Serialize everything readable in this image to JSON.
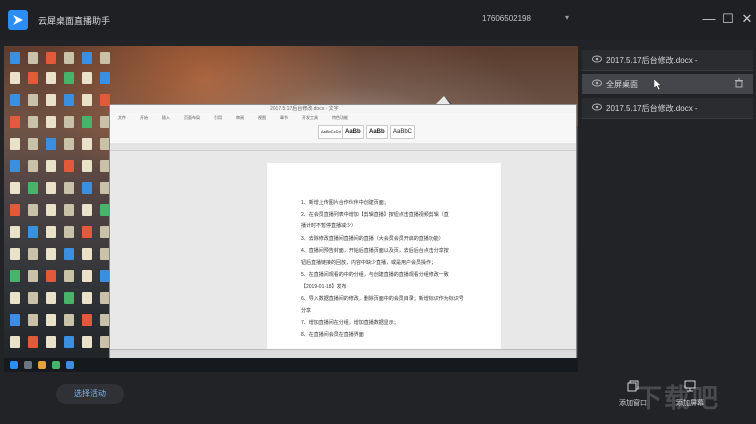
{
  "titlebar": {
    "app_name": "云犀桌面直播助手",
    "account": "17606502198",
    "account_caret": "▾",
    "minimize": "—",
    "maximize": "☐",
    "close": "✕"
  },
  "preview": {
    "word_window_title": "2017.5.17后台修改.docx - 文字",
    "word_tabs": [
      "文件",
      "开始",
      "插入",
      "页面布局",
      "引用",
      "审阅",
      "视图",
      "章节",
      "开发工具",
      "特色功能"
    ],
    "style_boxes": [
      "AaBbCcDd",
      "AaBb",
      "AaBb",
      "AaBbC"
    ],
    "doc_lines": [
      "1、新增上传图片合作伙伴中创建页面；",
      "2、在会员直播列表中增加【剪辑直播】按钮点击直播视频剪辑（直",
      "播计时不暂停直播减少）",
      "3、去除修改直播间直播间的直播（大会员会员开启的直播功能）",
      "4、直播间预告封面，开始后直播页面以及页，去后后台点击分享按",
      "钮后直播链接的回放，内容中缺少直播，或是用户会员操作；",
      "5、在直播间观看的中的分组，与创建直播的直播观看分组修改一致",
      "【2019-01-18】发布",
      "6、导入数据直播间的修改，删除页面中的会员目录；新增标识作为标识号",
      "分享",
      "7、增加直播间在分组，增加直播数据显示；",
      "8、在直播间会员在直播界面"
    ]
  },
  "sources": [
    {
      "label": "2017.5.17后台修改.docx -",
      "visible": true
    },
    {
      "label": "全屏桌面",
      "visible": true
    },
    {
      "label": "2017.5.17后台修改.docx -",
      "visible": true
    }
  ],
  "bottom": {
    "select_activity": "选择活动",
    "add_window": "添加窗口",
    "add_screen": "添加屏幕"
  },
  "watermark": "下载吧",
  "colors": {
    "accent": "#2a8ef5",
    "bg": "#222326",
    "panel": "#2b2c30",
    "selected": "#43454b"
  }
}
